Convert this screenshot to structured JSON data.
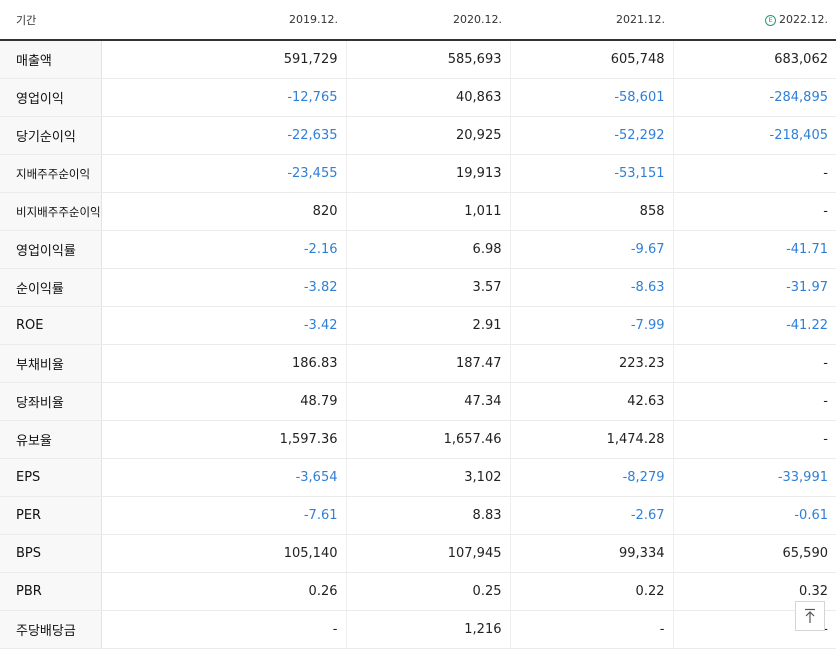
{
  "header": {
    "label": "기간",
    "years": [
      "2019.12.",
      "2020.12.",
      "2021.12.",
      "2022.12."
    ],
    "estimate_marker": "E"
  },
  "rows": [
    {
      "label": "매출액",
      "values": [
        "591,729",
        "585,693",
        "605,748",
        "683,062"
      ]
    },
    {
      "label": "영업이익",
      "values": [
        "-12,765",
        "40,863",
        "-58,601",
        "-284,895"
      ]
    },
    {
      "label": "당기순이익",
      "values": [
        "-22,635",
        "20,925",
        "-52,292",
        "-218,405"
      ]
    },
    {
      "label": "지배주주순이익",
      "values": [
        "-23,455",
        "19,913",
        "-53,151",
        "-"
      ]
    },
    {
      "label": "비지배주주순이익",
      "values": [
        "820",
        "1,011",
        "858",
        "-"
      ]
    },
    {
      "label": "영업이익률",
      "values": [
        "-2.16",
        "6.98",
        "-9.67",
        "-41.71"
      ]
    },
    {
      "label": "순이익률",
      "values": [
        "-3.82",
        "3.57",
        "-8.63",
        "-31.97"
      ]
    },
    {
      "label": "ROE",
      "values": [
        "-3.42",
        "2.91",
        "-7.99",
        "-41.22"
      ]
    },
    {
      "label": "부채비율",
      "values": [
        "186.83",
        "187.47",
        "223.23",
        "-"
      ]
    },
    {
      "label": "당좌비율",
      "values": [
        "48.79",
        "47.34",
        "42.63",
        "-"
      ]
    },
    {
      "label": "유보율",
      "values": [
        "1,597.36",
        "1,657.46",
        "1,474.28",
        "-"
      ]
    },
    {
      "label": "EPS",
      "values": [
        "-3,654",
        "3,102",
        "-8,279",
        "-33,991"
      ]
    },
    {
      "label": "PER",
      "values": [
        "-7.61",
        "8.83",
        "-2.67",
        "-0.61"
      ]
    },
    {
      "label": "BPS",
      "values": [
        "105,140",
        "107,945",
        "99,334",
        "65,590"
      ]
    },
    {
      "label": "PBR",
      "values": [
        "0.26",
        "0.25",
        "0.22",
        "0.32"
      ]
    },
    {
      "label": "주당배당금",
      "values": [
        "-",
        "1,216",
        "-",
        "-"
      ]
    }
  ],
  "colors": {
    "negative": "#2f7fd6",
    "estimate": "#1aa36c"
  },
  "scroll_top_icon": "arrow-up-to-top-icon"
}
